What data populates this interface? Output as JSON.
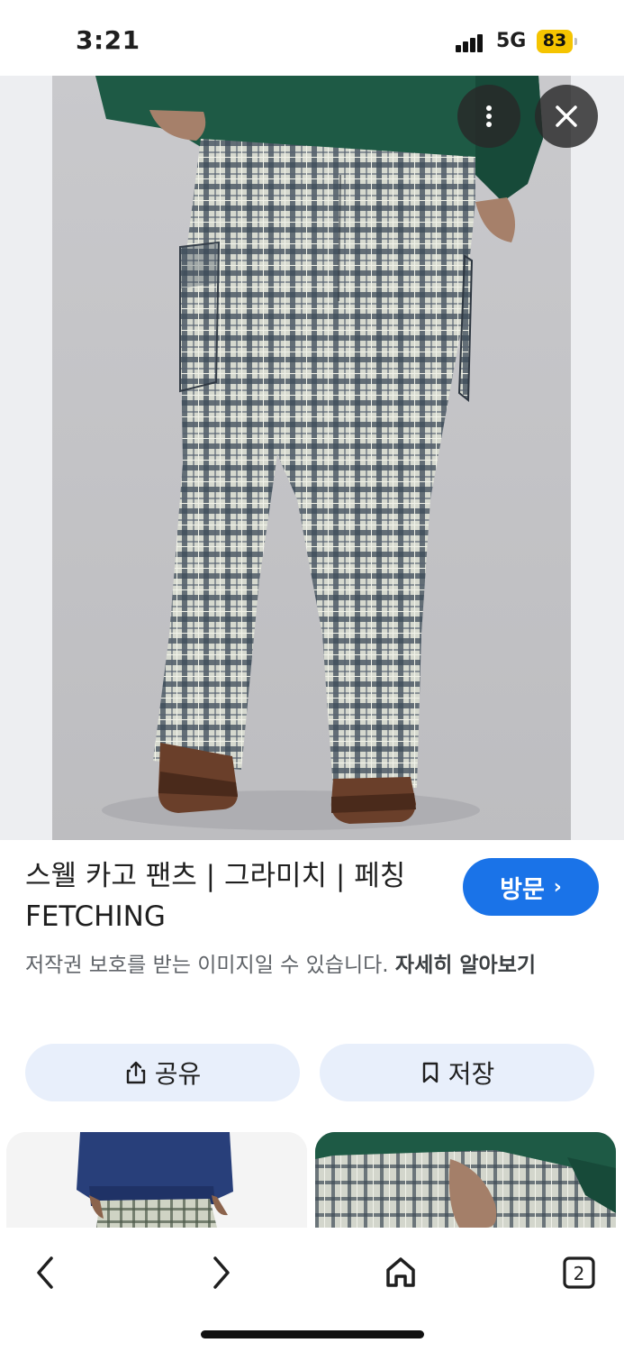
{
  "status_bar": {
    "time": "3:21",
    "network": "5G",
    "battery": "83",
    "battery_color": "#f5c400"
  },
  "viewer": {
    "image_subject": "plaid-cargo-pants-back-view",
    "more_icon": "more-vert-icon",
    "close_icon": "close-icon"
  },
  "result": {
    "title": "스웰 카고 팬츠 | 그라미치 | 페칭 FETCHING",
    "visit_label": "방문",
    "visit_chevron": "›",
    "copyright_text": "저작권 보호를 받는 이미지일 수 있습니다.",
    "learn_more": "자세히 알아보기"
  },
  "actions": {
    "share_label": "공유",
    "save_label": "저장"
  },
  "bottom_nav": {
    "tab_count": "2"
  },
  "colors": {
    "accent": "#1a73e8",
    "pill_bg": "#e8effb"
  }
}
